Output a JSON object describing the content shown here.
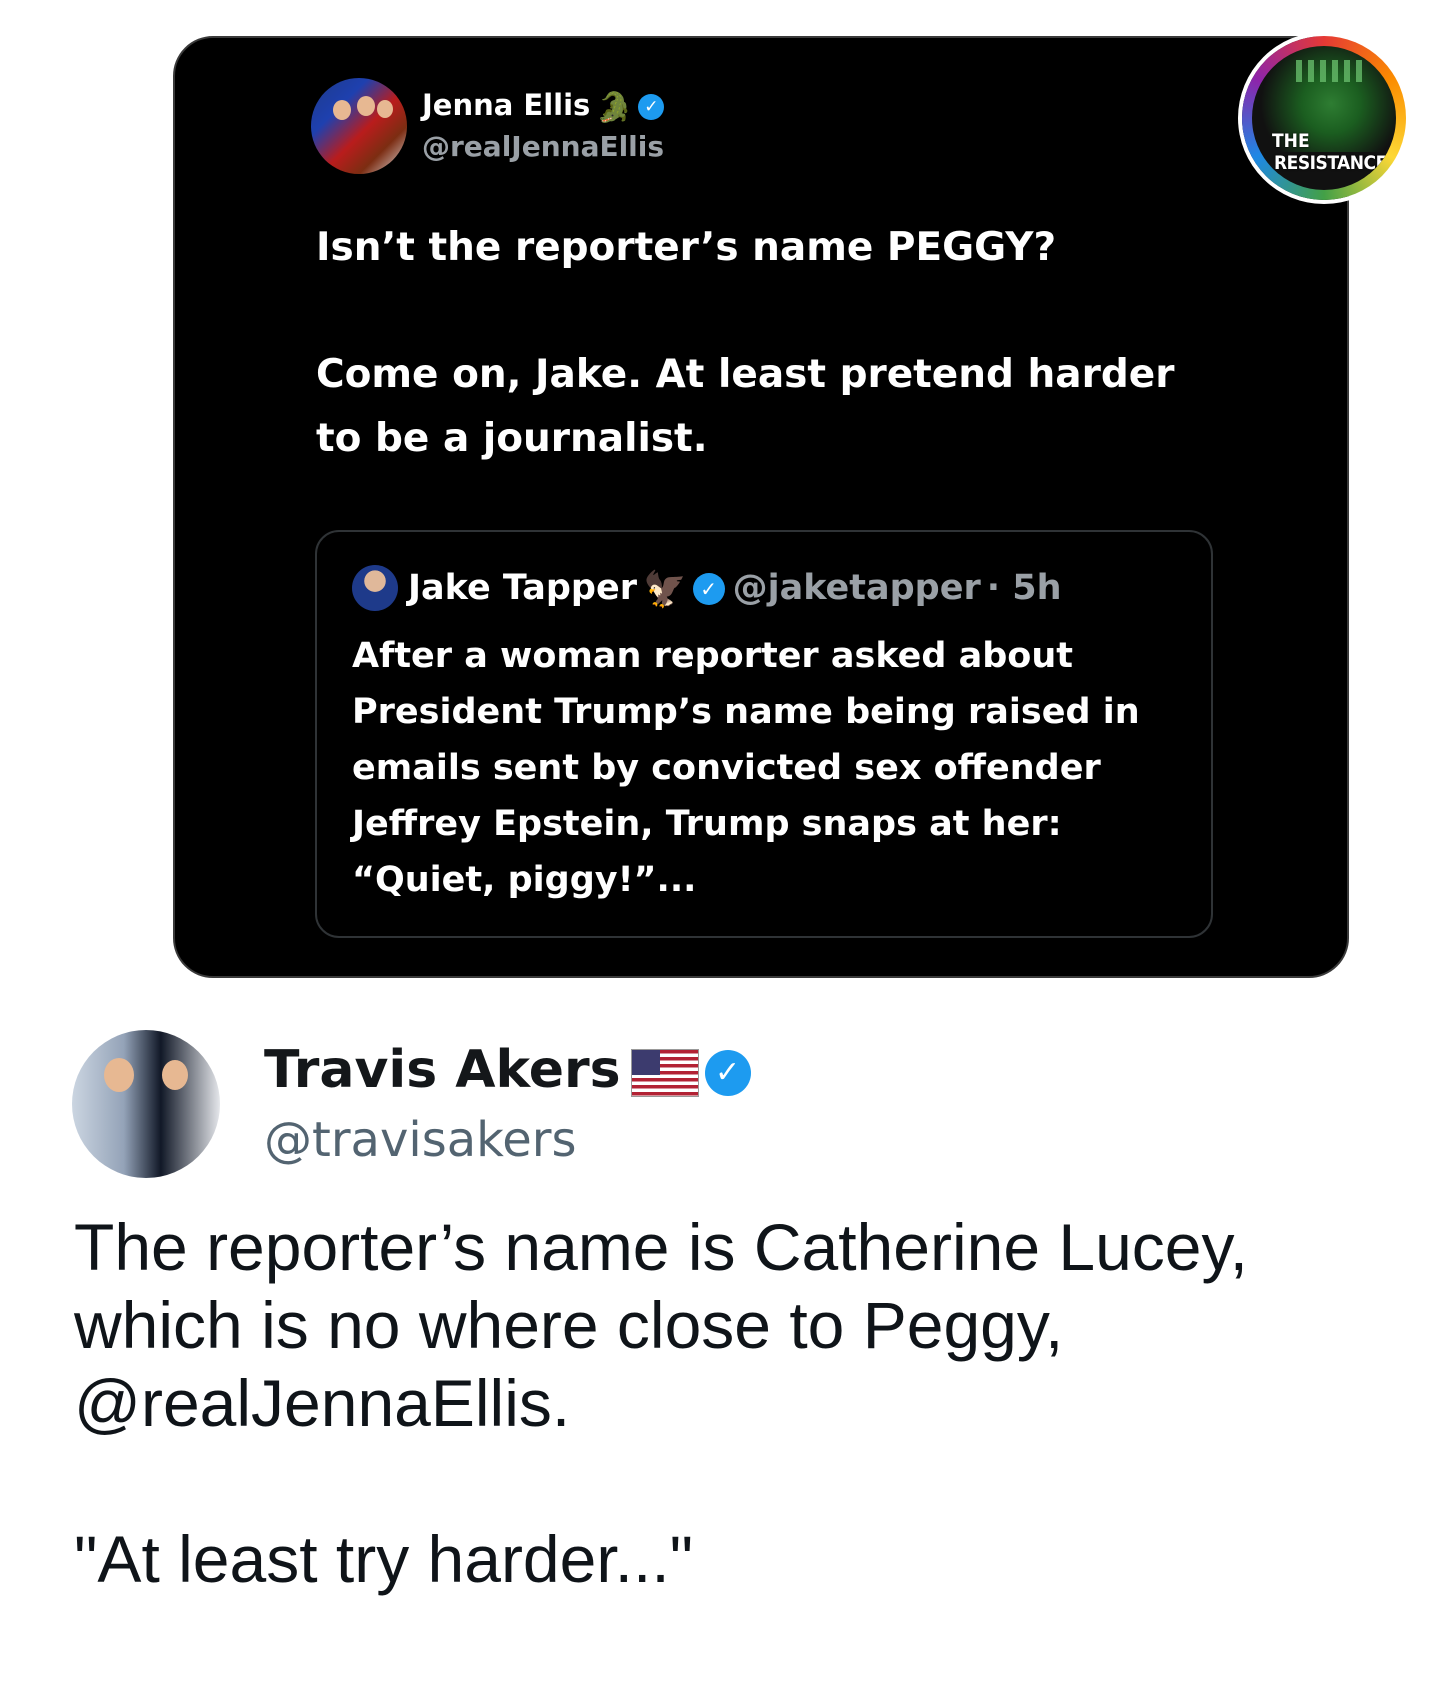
{
  "embedded_tweet": {
    "author_name": "Jenna Ellis",
    "author_emoji": "🐊",
    "author_handle": "@realJennaEllis",
    "verified_mark": "✓",
    "text_lines": [
      "Isn’t the reporter’s name PEGGY?",
      "Come on, Jake. At least pretend harder",
      "to be a journalist."
    ],
    "quoted": {
      "author_name": "Jake Tapper",
      "author_emoji": "🦅",
      "author_handle": "@jaketapper",
      "time": "· 5h",
      "text": "After a woman reporter asked about President Trump’s name being raised in emails sent by convicted sex offender Jeffrey Epstein, Trump snaps at her: “Quiet, piggy!”..."
    }
  },
  "badge": {
    "line1": "THE",
    "line2": "RESISTANCE"
  },
  "tweet": {
    "author_name": "Travis Akers",
    "author_handle": "@travisakers",
    "verified_mark": "✓",
    "text_paragraph_1": "The reporter’s name is Catherine Lucey, which is no where close to Peggy, @realJennaEllis.",
    "text_paragraph_2": "\"At least try harder...\""
  },
  "colors": {
    "card_background": "#000000",
    "verified_blue": "#1d9bf0",
    "handle_gray": "#536471"
  }
}
